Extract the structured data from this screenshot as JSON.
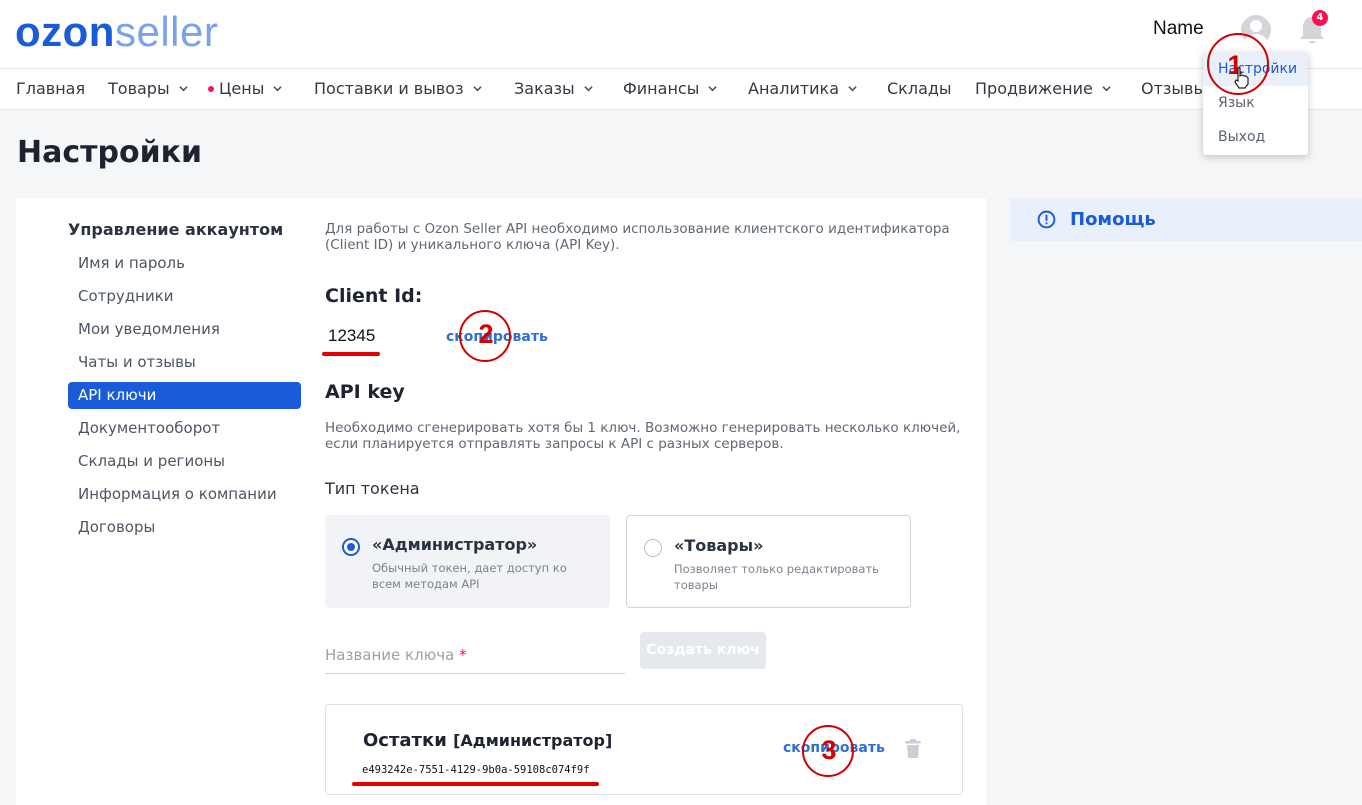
{
  "header": {
    "logo_primary": "ozon",
    "logo_secondary": "seller",
    "user_name": "Name",
    "notification_count": "4"
  },
  "nav": [
    {
      "label": "Главная",
      "has_menu": false,
      "dot": false
    },
    {
      "label": "Товары",
      "has_menu": true,
      "dot": false
    },
    {
      "label": "Цены",
      "has_menu": true,
      "dot": true
    },
    {
      "label": "Поставки и вывоз",
      "has_menu": true,
      "dot": false
    },
    {
      "label": "Заказы",
      "has_menu": true,
      "dot": false
    },
    {
      "label": "Финансы",
      "has_menu": true,
      "dot": false
    },
    {
      "label": "Аналитика",
      "has_menu": true,
      "dot": false
    },
    {
      "label": "Склады",
      "has_menu": false,
      "dot": false
    },
    {
      "label": "Продвижение",
      "has_menu": true,
      "dot": false
    },
    {
      "label": "Отзывы",
      "has_menu": false,
      "dot": false
    }
  ],
  "user_menu": [
    "Настройки",
    "Язык",
    "Выход"
  ],
  "page_title": "Настройки",
  "sidebar": {
    "title": "Управление аккаунтом",
    "items": [
      "Имя и пароль",
      "Сотрудники",
      "Мои уведомления",
      "Чаты и отзывы",
      "API ключи",
      "Документооборот",
      "Склады и регионы",
      "Информация о компании",
      "Договоры"
    ],
    "active": "API ключи"
  },
  "main": {
    "intro": "Для работы с Ozon Seller API необходимо использование клиентского идентификатора (Client ID) и уникального ключа (API Key).",
    "client_id_title": "Client Id:",
    "client_id_value": "12345",
    "copy_label": "скопировать",
    "api_key_title": "API key",
    "api_key_desc": "Необходимо сгенерировать хотя бы 1 ключ. Возможно генерировать несколько ключей, если планируется отправлять запросы к API с разных серверов.",
    "token_type_label": "Тип токена",
    "tokens": [
      {
        "title": "«Администратор»",
        "desc": "Обычный токен, дает доступ ко всем методам API",
        "selected": true
      },
      {
        "title": "«Товары»",
        "desc": "Позволяет только редактировать товары",
        "selected": false
      }
    ],
    "key_name_placeholder": "Название ключа",
    "required_mark": "*",
    "create_button": "Создать ключ",
    "key": {
      "name": "Остатки",
      "role": "[Администратор]",
      "value": "e493242e-7551-4129-9b0a-59108c074f9f",
      "copy_label": "скопировать"
    }
  },
  "help": {
    "label": "Помощь"
  },
  "annotations": [
    "1",
    "2",
    "3"
  ],
  "colors": {
    "brand_blue": "#1a5bd9",
    "badge_pink": "#f91155",
    "annotation_red": "#d40000"
  }
}
